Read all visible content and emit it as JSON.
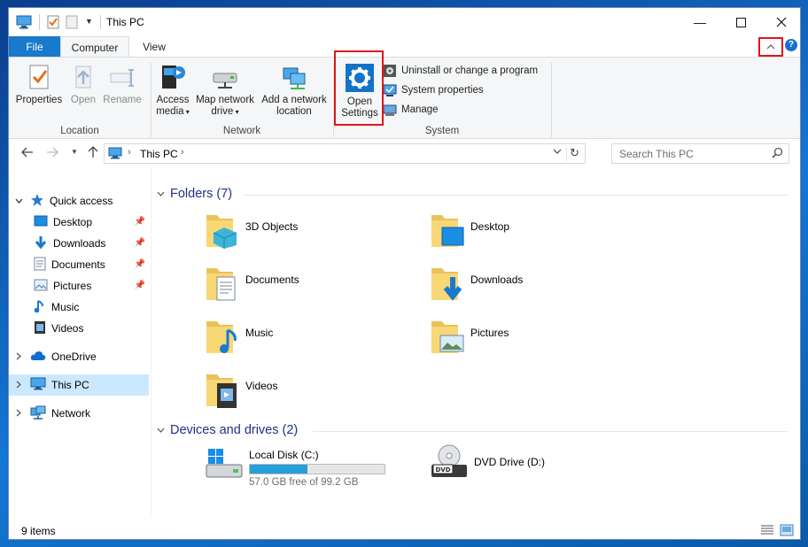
{
  "window": {
    "title": "This PC"
  },
  "tabs": [
    {
      "label": "File"
    },
    {
      "label": "Computer"
    },
    {
      "label": "View"
    }
  ],
  "ribbon": {
    "location": {
      "label": "Location",
      "properties": "Properties",
      "open": "Open",
      "rename": "Rename"
    },
    "network": {
      "label": "Network",
      "access_media": [
        "Access",
        "media"
      ],
      "map_network_drive": [
        "Map network",
        "drive"
      ],
      "add_network_location": [
        "Add a network",
        "location"
      ]
    },
    "system": {
      "label": "System",
      "open_settings": [
        "Open",
        "Settings"
      ],
      "uninstall": "Uninstall or change a program",
      "system_properties": "System properties",
      "manage": "Manage"
    }
  },
  "address": {
    "path": "This PC",
    "search_placeholder": "Search This PC"
  },
  "nav": {
    "quick_access": "Quick access",
    "desktop": "Desktop",
    "downloads": "Downloads",
    "documents": "Documents",
    "pictures": "Pictures",
    "music": "Music",
    "videos": "Videos",
    "onedrive": "OneDrive",
    "this_pc": "This PC",
    "network": "Network"
  },
  "content": {
    "folders_header": "Folders (7)",
    "folders": [
      {
        "name": "3D Objects"
      },
      {
        "name": "Desktop"
      },
      {
        "name": "Documents"
      },
      {
        "name": "Downloads"
      },
      {
        "name": "Music"
      },
      {
        "name": "Pictures"
      },
      {
        "name": "Videos"
      }
    ],
    "drives_header": "Devices and drives (2)",
    "drives": [
      {
        "name": "Local Disk (C:)",
        "free": "57.0 GB free of 99.2 GB",
        "used_fraction": 0.425
      },
      {
        "name": "DVD Drive (D:)"
      }
    ]
  },
  "status": {
    "items": "9 items"
  },
  "colors": {
    "accent": "#1979ca",
    "highlight_box": "#e0161d",
    "selection": "#cce8ff",
    "drive_bar": "#26a0da"
  }
}
